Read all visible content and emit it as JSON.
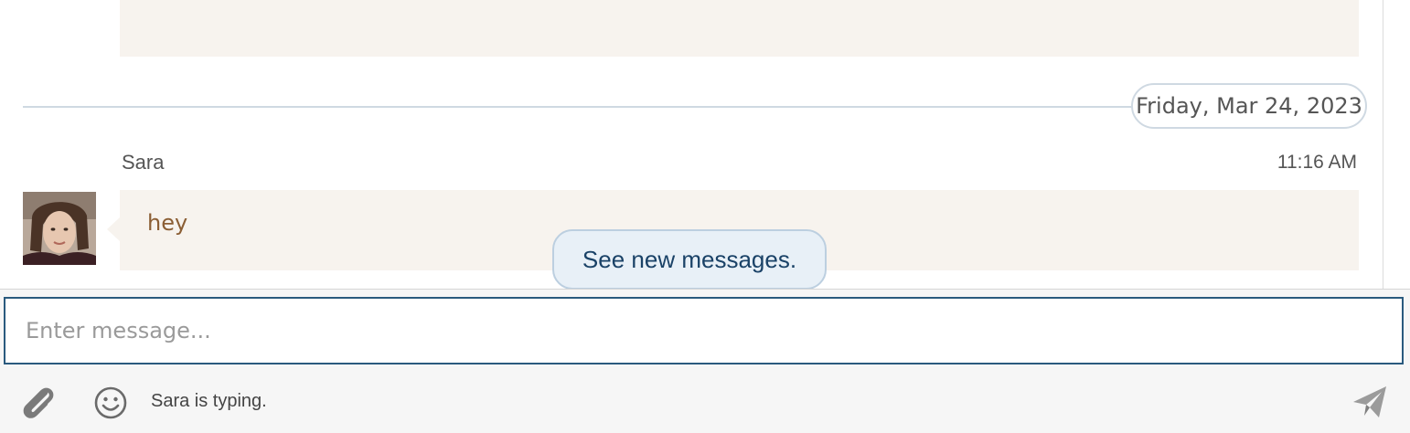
{
  "conversation": {
    "date_divider": "Friday, Mar 24, 2023",
    "message": {
      "sender": "Sara",
      "time": "11:16 AM",
      "text": "hey",
      "avatar_icon": "user-avatar-photo"
    },
    "new_messages_label": "See new messages."
  },
  "composer": {
    "placeholder": "Enter message...",
    "value": "",
    "typing_status": "Sara is typing.",
    "icons": {
      "attach": "paperclip-icon",
      "emoji": "smiley-icon",
      "send": "paper-plane-icon"
    }
  },
  "colors": {
    "bubble_bg": "#f7f3ee",
    "message_text": "#8b5e34",
    "input_border": "#2a5a7e",
    "pill_bg": "#e8f0f7",
    "pill_text": "#1a4267"
  }
}
